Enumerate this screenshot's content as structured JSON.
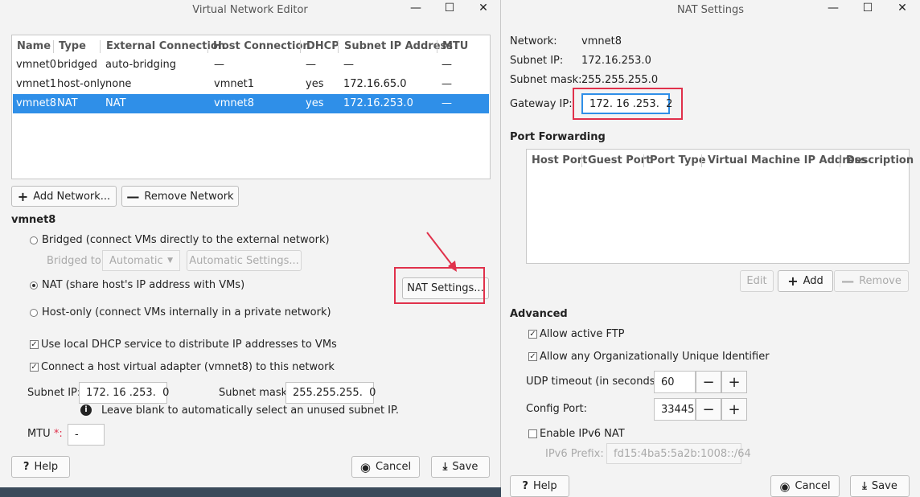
{
  "vne": {
    "title": "Virtual Network Editor",
    "table": {
      "headers": [
        "Name",
        "Type",
        "External Connection",
        "Host Connection",
        "DHCP",
        "Subnet IP Address",
        "MTU"
      ],
      "rows": [
        [
          "vmnet0",
          "bridged",
          "auto-bridging",
          "—",
          "—",
          "—",
          "—"
        ],
        [
          "vmnet1",
          "host-only",
          "none",
          "vmnet1",
          "yes",
          "172.16.65.0",
          "—"
        ],
        [
          "vmnet8",
          "NAT",
          "NAT",
          "vmnet8",
          "yes",
          "172.16.253.0",
          "—"
        ]
      ]
    },
    "add_network": "Add Network...",
    "remove_network": "Remove Network",
    "section_title": "vmnet8",
    "bridged_radio": "Bridged (connect VMs directly to the external network)",
    "bridged_to_label": "Bridged to:",
    "bridged_to_value": "Automatic",
    "automatic_settings": "Automatic Settings...",
    "nat_radio": "NAT (share host's IP address with VMs)",
    "nat_settings": "NAT Settings...",
    "hostonly_radio": "Host-only (connect VMs internally in a private network)",
    "dhcp_check": "Use local DHCP service to distribute IP addresses to VMs",
    "adapter_check": "Connect a host virtual adapter (vmnet8) to this network",
    "subnet_ip_label": "Subnet IP:",
    "subnet_ip_value": "172. 16 .253.  0",
    "subnet_mask_label": "Subnet mask:",
    "subnet_mask_value": "255.255.255.  0",
    "info_text": "Leave blank to automatically select an unused subnet IP.",
    "mtu_label": "MTU",
    "mtu_star": "*:",
    "mtu_value": "-",
    "help": "Help",
    "cancel": "Cancel",
    "save": "Save"
  },
  "nat": {
    "title": "NAT Settings",
    "network_label": "Network:",
    "network_value": "vmnet8",
    "subnet_ip_label": "Subnet IP:",
    "subnet_ip_value": "172.16.253.0",
    "subnet_mask_label": "Subnet mask:",
    "subnet_mask_value": "255.255.255.0",
    "gateway_label": "Gateway IP:",
    "gateway_value": "172. 16 .253.  2",
    "port_forwarding_title": "Port Forwarding",
    "pf_headers": [
      "Host Port",
      "Guest Port",
      "Port Type",
      "Virtual Machine IP Address",
      "Description"
    ],
    "edit": "Edit",
    "add": "Add",
    "remove": "Remove",
    "advanced_title": "Advanced",
    "allow_ftp": "Allow active FTP",
    "allow_oui": "Allow any Organizationally Unique Identifier",
    "udp_label": "UDP timeout (in seconds):",
    "udp_value": "60",
    "config_port_label": "Config Port:",
    "config_port_value": "33445",
    "ipv6_check": "Enable IPv6 NAT",
    "ipv6_prefix_label": "IPv6 Prefix:",
    "ipv6_prefix_value": "fd15:4ba5:5a2b:1008::/64",
    "help": "Help",
    "cancel": "Cancel",
    "save": "Save"
  },
  "colors": {
    "accent": "#2f8fe8",
    "highlight": "#e0314b"
  }
}
